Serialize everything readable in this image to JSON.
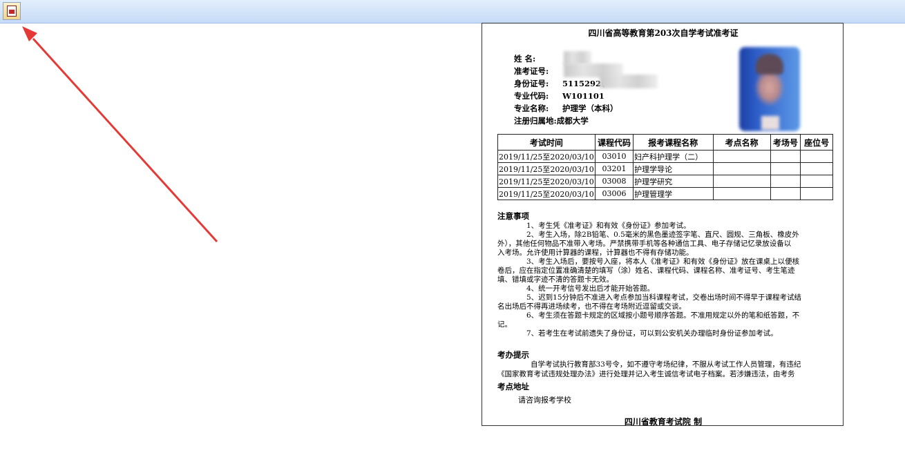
{
  "toolbar": {
    "print_icon": "pdf-print-icon"
  },
  "annotation": {
    "color": "#e53935"
  },
  "ticket": {
    "title": "四川省高等教育第203次自学考试准考证",
    "fields": {
      "name_label": "姓    名:",
      "ticket_no_label": "准考证号:",
      "id_label": "身份证号:",
      "id_value": "5115292(",
      "major_code_label": "专业代码:",
      "major_code_value": "W101101",
      "major_name_label": "专业名称:",
      "major_name_value": "护理学（本科）",
      "reg_label": "注册归属地:",
      "reg_value": "成都大学"
    },
    "table": {
      "headers": [
        "考试时间",
        "课程代码",
        "报考课程名称",
        "考点名称",
        "考场号",
        "座位号"
      ],
      "rows": [
        [
          "2019/11/25至2020/03/10",
          "03010",
          "妇产科护理学（二）",
          "",
          "",
          ""
        ],
        [
          "2019/11/25至2020/03/10",
          "03201",
          "护理学导论",
          "",
          "",
          ""
        ],
        [
          "2019/11/25至2020/03/10",
          "03008",
          "护理学研究",
          "",
          "",
          ""
        ],
        [
          "2019/11/25至2020/03/10",
          "03006",
          "护理管理学",
          "",
          "",
          ""
        ]
      ]
    },
    "notes_title": "注意事项",
    "notes": [
      "1、考生凭《准考证》和有效《身份证》参加考试。",
      "2、考生入场，除2B铅笔、0.5毫米的黑色墨迹签字笔、直尺、圆规、三角板、橡皮外",
      "外），其他任何物品不准带入考场。严禁携带手机等各种通信工具、电子存储记忆录放设备以",
      "入考场。允许使用计算器的课程，计算器也不得有存储功能。",
      "3、考生入场后，要按号入座，将本人《准考证》和有效《身份证》放在课桌上以便核",
      "卷后，应在指定位置准确清楚的填写（涂）姓名、课程代码、课程名称、准考证号、考生笔迹",
      "填、错填或字迹不清的答题卡无效。",
      "4、统一开考信号发出后才能开始答题。",
      "5、迟到15分钟后不准进入考点参加当科课程考试，交卷出场时间不得早于课程考试结",
      "名出场后不得再进场续考，也不得在考场附近逗留或交谈。",
      "6、考生须在答题卡规定的区域按小题号顺序答题。不准用规定以外的笔和纸答题，不",
      "记。",
      "7、若考生在考试前遗失了身份证，可以到公安机关办理临时身份证参加考试。"
    ],
    "tips_title": "考办提示",
    "tips": [
      "自学考试执行教育部33号令，如不遵守考场纪律，不服从考试工作人员管理，有违纪",
      "《国家教育考试违规处理办法》进行处理并记入考生诚信考试电子档案。若涉嫌违法，由考务"
    ],
    "address_title": "考点地址",
    "address": "请咨询报考学校",
    "issuer": "四川省教育考试院    制"
  }
}
